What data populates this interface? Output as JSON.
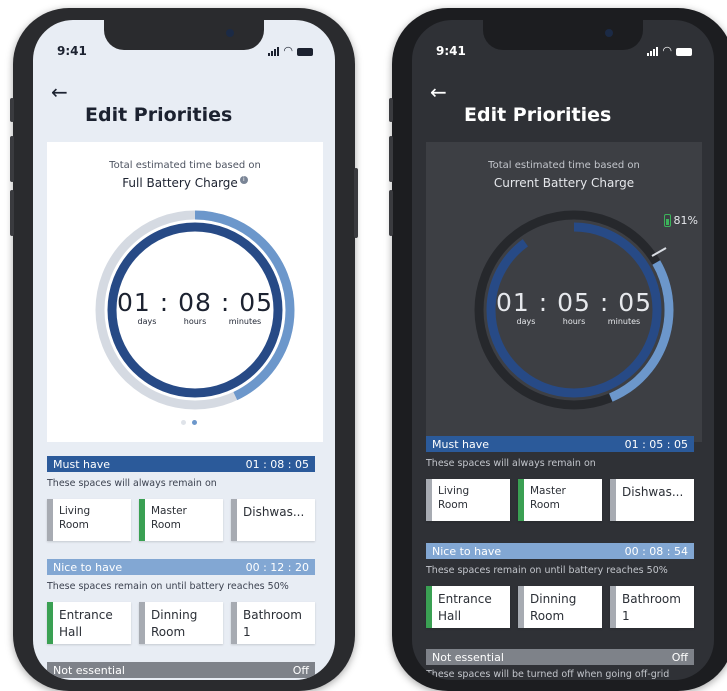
{
  "colors": {
    "must": "#2b5a9a",
    "nice": "#82a7d3",
    "notess": "#7e8289",
    "ring_dark": "#274a86",
    "ring_light": "#6c97cb",
    "battery_green": "#3cb35a"
  },
  "phones": [
    {
      "theme": "light",
      "status": {
        "time": "9:41"
      },
      "header": {
        "back_icon": "←",
        "title": "Edit Priorities"
      },
      "summary": {
        "caption": "Total estimated time based on",
        "basis": "Full Battery Charge",
        "info_icon": "i",
        "time": "01 : 08 : 05",
        "units": [
          "days",
          "hours",
          "minutes"
        ],
        "carousel_active_index": 1
      },
      "sections": [
        {
          "label": "Must have",
          "time": "01 : 08 : 05",
          "subtitle": "These spaces will always remain on",
          "tiles": [
            {
              "name": "Living\nRoom",
              "on": false
            },
            {
              "name": "Master\nRoom",
              "on": true
            },
            {
              "name": "Dishwas...",
              "on": false
            }
          ]
        },
        {
          "label": "Nice to have",
          "time": "00 : 12 : 20",
          "subtitle": "These spaces remain on until battery reaches 50%",
          "tiles": [
            {
              "name": "Entrance\nHall",
              "on": true
            },
            {
              "name": "Dinning\nRoom",
              "on": false
            },
            {
              "name": "Bathroom\n1",
              "on": false
            }
          ]
        },
        {
          "label": "Not essential",
          "time": "Off"
        }
      ]
    },
    {
      "theme": "dark",
      "status": {
        "time": "9:41"
      },
      "header": {
        "back_icon": "←",
        "title": "Edit Priorities"
      },
      "summary": {
        "caption": "Total estimated time based on",
        "basis": "Current Battery Charge",
        "battery_percent": "81%",
        "time": "01 : 05 : 05",
        "units": [
          "days",
          "hours",
          "minutes"
        ]
      },
      "sections": [
        {
          "label": "Must have",
          "time": "01 : 05 : 05",
          "subtitle": "These spaces will always remain on",
          "tiles": [
            {
              "name": "Living\nRoom",
              "on": false
            },
            {
              "name": "Master\nRoom",
              "on": true
            },
            {
              "name": "Dishwas...",
              "on": false
            }
          ]
        },
        {
          "label": "Nice to have",
          "time": "00 : 08 : 54",
          "subtitle": "These spaces remain on until battery reaches 50%",
          "tiles": [
            {
              "name": "Entrance\nHall",
              "on": true
            },
            {
              "name": "Dinning\nRoom",
              "on": false
            },
            {
              "name": "Bathroom\n1",
              "on": false
            }
          ]
        },
        {
          "label": "Not essential",
          "time": "Off",
          "subtitle": "These spaces will be turned off when going off-grid"
        }
      ]
    }
  ]
}
